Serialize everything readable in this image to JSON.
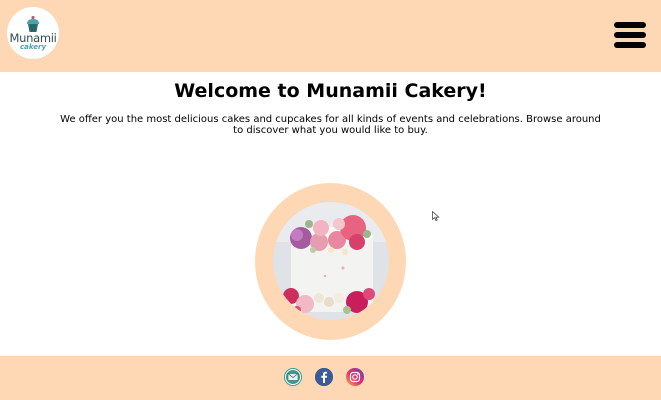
{
  "header": {
    "logo": {
      "name": "Munamii",
      "sub": "cakery",
      "icon": "cupcake-icon"
    },
    "menu": {
      "icon": "hamburger-menu-icon"
    }
  },
  "main": {
    "title": "Welcome to Munamii Cakery!",
    "intro": "We offer you the most delicious cakes and cupcakes for all kinds of events and celebrations. Browse around to discover what you would like to buy.",
    "hero_image": "flower-cake-image"
  },
  "footer": {
    "social": [
      {
        "icon": "email-icon"
      },
      {
        "icon": "facebook-icon"
      },
      {
        "icon": "instagram-icon"
      }
    ]
  },
  "colors": {
    "accent": "#fed8b4",
    "logo_text": "#2c4f52",
    "logo_teal": "#4aa3a8"
  }
}
